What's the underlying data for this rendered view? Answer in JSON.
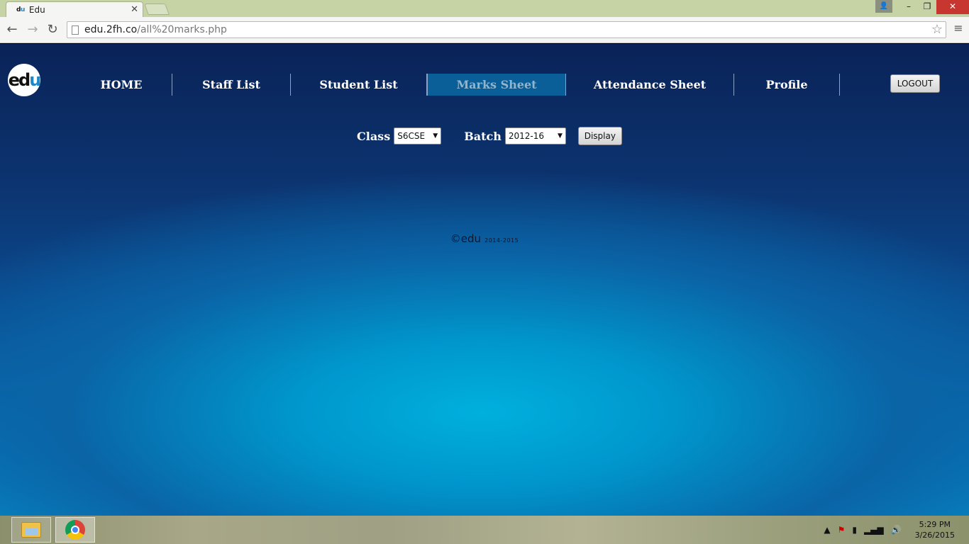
{
  "browser": {
    "tab_title": "Edu",
    "tab_favicon_text_a": "d",
    "tab_favicon_text_b": "u",
    "url_host": "edu.2fh.co",
    "url_path": "/all%20marks.php"
  },
  "site": {
    "logo_a": "e",
    "logo_b": "d",
    "logo_c": "u",
    "nav": [
      {
        "label": "HOME",
        "active": false
      },
      {
        "label": "Staff List",
        "active": false
      },
      {
        "label": "Student List",
        "active": false
      },
      {
        "label": "Marks Sheet",
        "active": true
      },
      {
        "label": "Attendance Sheet",
        "active": false
      },
      {
        "label": "Profile",
        "active": false
      }
    ],
    "logout_label": "LOGOUT"
  },
  "filter": {
    "class_label": "Class",
    "class_value": "S6CSE",
    "batch_label": "Batch",
    "batch_value": "2012-16",
    "display_label": "Display"
  },
  "footer": {
    "copyright": "©edu",
    "years": "2014-2015"
  },
  "taskbar": {
    "time": "5:29 PM",
    "date": "3/26/2015"
  },
  "colors": {
    "nav_active_bg": "#0a5f98",
    "nav_active_text": "#8fb5cf",
    "page_top": "#0a2358",
    "page_glow": "#00b0dd",
    "logo_accent": "#1e88c8"
  }
}
